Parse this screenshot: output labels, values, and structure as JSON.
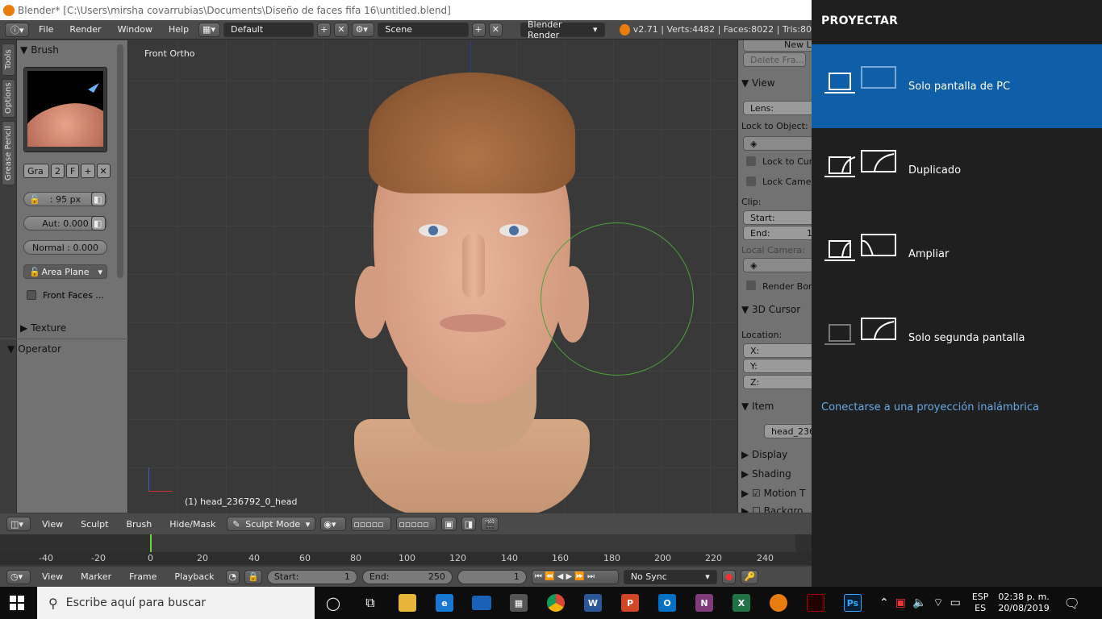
{
  "window_title": "Blender* [C:\\Users\\mirsha covarrubias\\Documents\\Diseño de faces fifa 16\\untitled.blend]",
  "menu": {
    "file": "File",
    "render": "Render",
    "window": "Window",
    "help": "Help",
    "layout": "Default",
    "scene": "Scene",
    "engine": "Blender Render",
    "stats": "v2.71 | Verts:4482 | Faces:8022 | Tris:80"
  },
  "tabs": {
    "tools": "Tools",
    "options": "Options",
    "grease": "Grease Pencil"
  },
  "toolshelf": {
    "brush_header": "Brush",
    "brush_name": "Gra",
    "brush_users": "2",
    "brush_fake": "F",
    "radius": ": 95 px",
    "autosmooth": "Aut: 0.000",
    "normal": "Normal : 0.000",
    "area": "Area Plane",
    "front_faces": "Front Faces ...",
    "texture": "Texture",
    "operator": "Operator"
  },
  "viewport": {
    "view_label": "Front Ortho",
    "object_label": "(1) head_236792_0_head"
  },
  "props": {
    "new_layer": "New La",
    "delete_frame": "Delete Fra...",
    "view_header": "View",
    "lens": "Lens:",
    "lock_object": "Lock to Object:",
    "lock_cursor": "Lock to Curs",
    "lock_camera": "Lock Camer",
    "clip": "Clip:",
    "start": "Start:",
    "end": "End:",
    "end_val": "1",
    "local_camera": "Local Camera:",
    "render_border": "Render Bord",
    "cursor_header": "3D Cursor",
    "location": "Location:",
    "x": "X:",
    "y": "Y:",
    "z": "Z:",
    "item_header": "Item",
    "item_name": "head_236",
    "display": "Display",
    "shading": "Shading",
    "motion": "Motion T",
    "background": "Backgro"
  },
  "header3d": {
    "view": "View",
    "sculpt": "Sculpt",
    "brush": "Brush",
    "hidemask": "Hide/Mask",
    "mode": "Sculpt Mode"
  },
  "ruler": [
    "-40",
    "-20",
    "0",
    "20",
    "40",
    "60",
    "80",
    "100",
    "120",
    "140",
    "160",
    "180",
    "200",
    "220",
    "240"
  ],
  "timeline_header": {
    "view": "View",
    "marker": "Marker",
    "frame": "Frame",
    "playback": "Playback",
    "start": "Start:",
    "start_val": "1",
    "end": "End:",
    "end_val": "250",
    "current": "1",
    "sync": "No Sync"
  },
  "flyout": {
    "title": "PROYECTAR",
    "options": [
      {
        "label": "Solo pantalla de PC"
      },
      {
        "label": "Duplicado"
      },
      {
        "label": "Ampliar"
      },
      {
        "label": "Solo segunda pantalla"
      }
    ],
    "link": "Conectarse a una proyección inalámbrica"
  },
  "taskbar": {
    "search_placeholder": "Escribe aquí para buscar",
    "lang1": "ESP",
    "lang2": "ES",
    "time": "02:38 p. m.",
    "date": "20/08/2019"
  },
  "colors": {
    "accent": "#0e5ea8",
    "link": "#68a8e8",
    "blender_orange": "#e87d0d"
  }
}
